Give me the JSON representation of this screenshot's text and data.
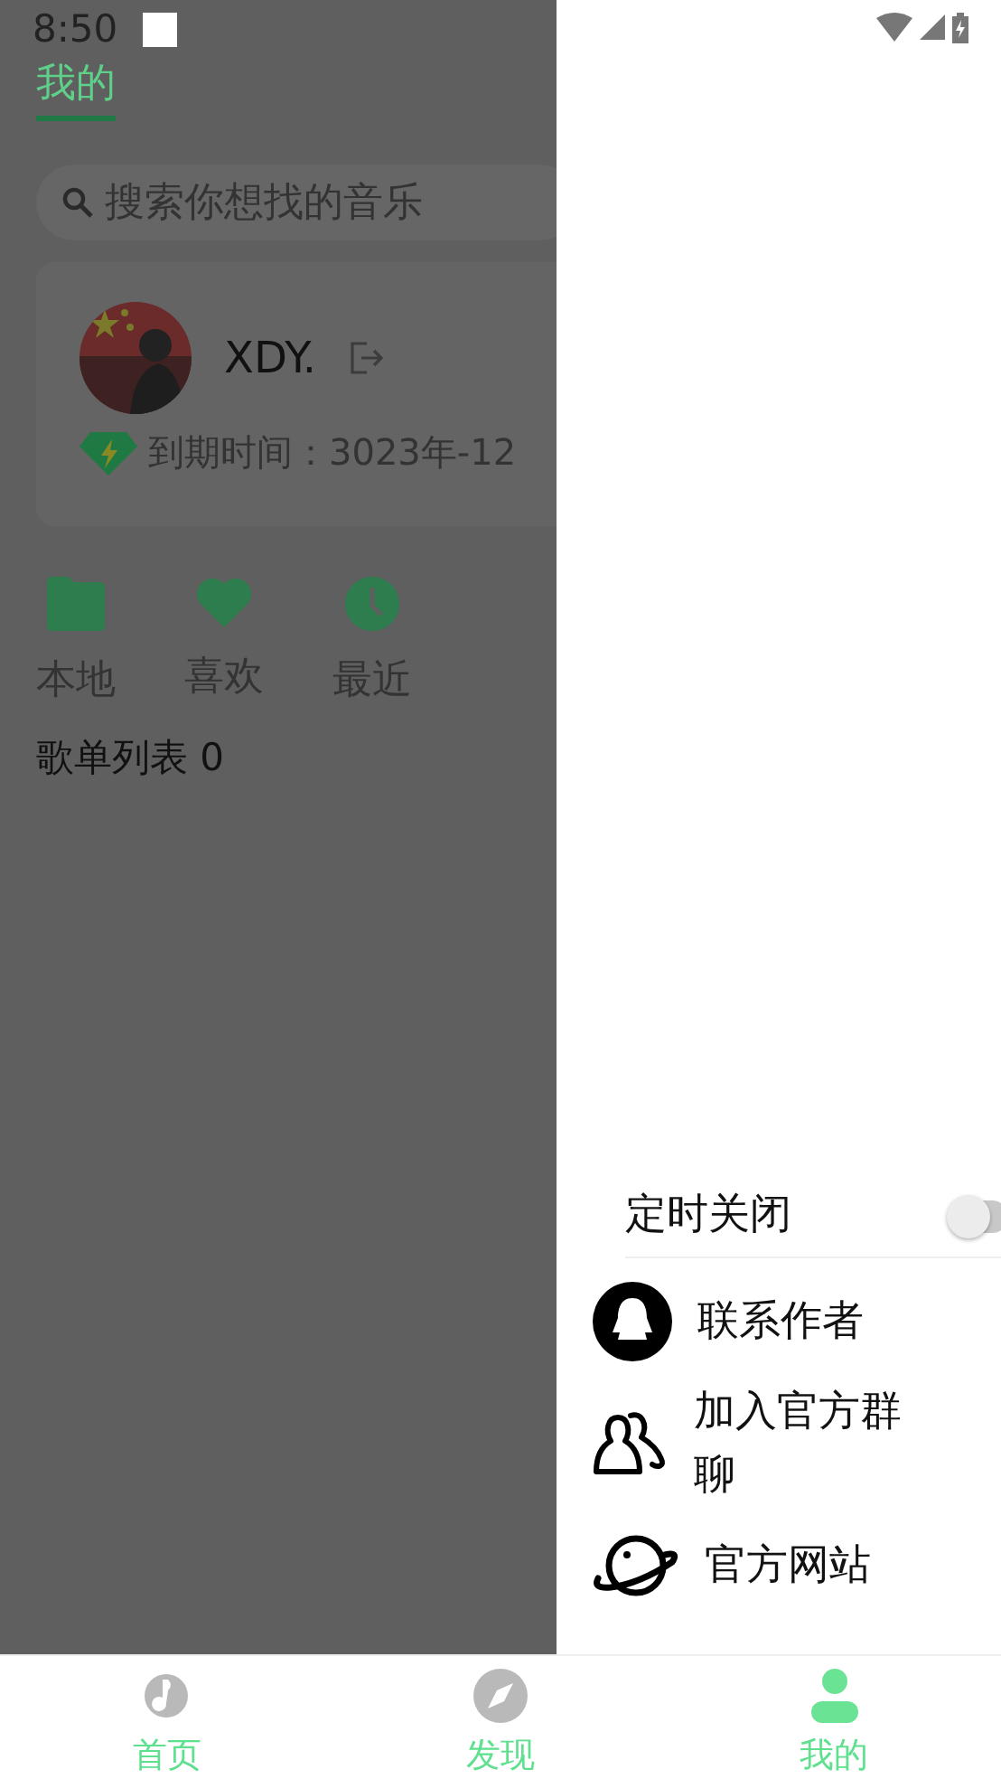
{
  "status_bar": {
    "time": "8:50"
  },
  "header": {
    "title": "我的"
  },
  "search": {
    "placeholder": "搜索你想找的音乐"
  },
  "profile": {
    "name": "XDY.",
    "expiry": "到期时间：3023年-12"
  },
  "shortcuts": [
    {
      "label": "本地"
    },
    {
      "label": "喜欢"
    },
    {
      "label": "最近"
    }
  ],
  "playlist_heading": "歌单列表 0",
  "drawer": {
    "timer": {
      "label": "定时关闭",
      "on": false
    },
    "items": [
      {
        "label": "联系作者"
      },
      {
        "label": "加入官方群聊"
      },
      {
        "label": "官方网站"
      }
    ]
  },
  "bottom_nav": [
    {
      "label": "首页",
      "selected": false
    },
    {
      "label": "发现",
      "selected": false
    },
    {
      "label": "我的",
      "selected": true
    }
  ]
}
